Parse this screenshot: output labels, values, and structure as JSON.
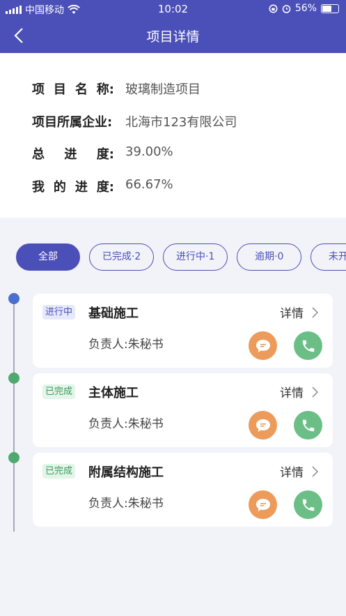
{
  "status_bar": {
    "carrier": "中国移动",
    "time": "10:02",
    "battery": "56%"
  },
  "nav": {
    "title": "项目详情"
  },
  "info": {
    "project_name_label": [
      "项",
      "目",
      "名",
      "称:"
    ],
    "project_name_value": "玻璃制造项目",
    "company_label": "项目所属企业:",
    "company_value": "北海市123有限公司",
    "total_progress_label": [
      "总",
      "进",
      "度:"
    ],
    "total_progress_value": "39.00%",
    "my_progress_label": [
      "我",
      "的",
      "进",
      "度:"
    ],
    "my_progress_value": "66.67%"
  },
  "filters": [
    {
      "label": "全部",
      "active": true
    },
    {
      "label": "已完成·2",
      "active": false
    },
    {
      "label": "进行中·1",
      "active": false
    },
    {
      "label": "逾期·0",
      "active": false
    },
    {
      "label": "未开始",
      "active": false
    }
  ],
  "detail_label": "详情",
  "tasks": [
    {
      "status": "进行中",
      "status_type": "progress",
      "name": "基础施工",
      "owner": "负责人:朱秘书",
      "dot_color": "#4b6fd1"
    },
    {
      "status": "已完成",
      "status_type": "done",
      "name": "主体施工",
      "owner": "负责人:朱秘书",
      "dot_color": "#4fa96e"
    },
    {
      "status": "已完成",
      "status_type": "done",
      "name": "附属结构施工",
      "owner": "负责人:朱秘书",
      "dot_color": "#4fa96e"
    }
  ],
  "colors": {
    "primary": "#4b4fb8",
    "message": "#ec9b5b",
    "call": "#6bbf86"
  },
  "icons": [
    "signal-icon",
    "wifi-icon",
    "lock-rotation-icon",
    "alarm-icon",
    "battery-icon",
    "back-arrow-icon",
    "chevron-right-icon",
    "message-icon",
    "phone-icon"
  ]
}
